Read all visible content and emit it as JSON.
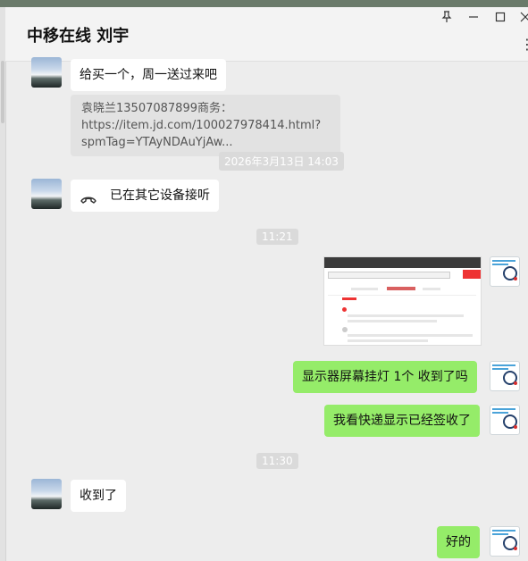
{
  "window": {
    "title": "中移在线 刘宇",
    "controls": [
      "pin",
      "minimize",
      "maximize",
      "close"
    ],
    "more": "⋮"
  },
  "messages": {
    "m1": "给买一个，周一送过来吧",
    "m2_link": "袁晓兰13507087899商务：https://item.jd.com/100027978414.html?spmTag=YTAyNDAuYjAw...",
    "t1": "2026年3月13日 14:03",
    "m3": "已在其它设备接听",
    "t2": "11:21",
    "m5": "显示器屏幕挂灯 1个  收到了吗",
    "m6": "我看快递显示已经签收了",
    "t3": "11:30",
    "m7": "收到了",
    "m8": "好的"
  },
  "colors": {
    "sent_bubble": "#95ec69",
    "received_bubble": "#ffffff",
    "chat_bg": "#ededed"
  },
  "icons": {
    "pin": "pin-icon",
    "minimize": "minimize-icon",
    "maximize": "maximize-icon",
    "close": "close-icon",
    "call": "phone-hangup-icon"
  }
}
